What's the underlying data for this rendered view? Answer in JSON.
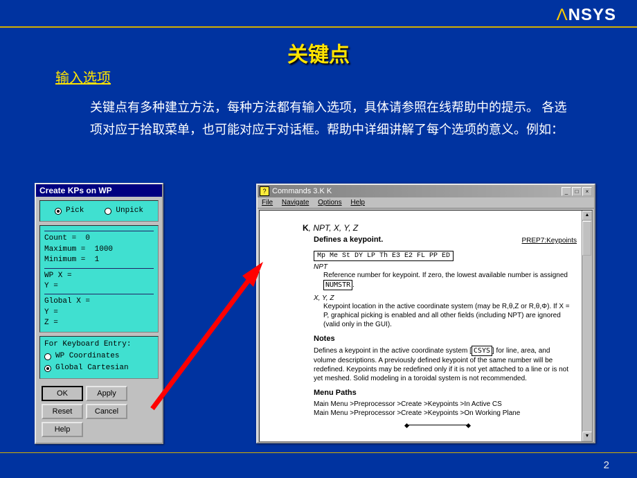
{
  "logo": {
    "brand_prefix": "Λ",
    "brand": "NSYS"
  },
  "page_number": "2",
  "title": "关键点",
  "subtitle": "输入选项",
  "body": "关键点有多种建立方法，每种方法都有输入选项，具体请参照在线帮助中的提示。 各选项对应于拾取菜单，也可能对应于对话框。帮助中详细讲解了每个选项的意义。例如：",
  "dialog1": {
    "title": "Create KPs on WP",
    "pick": "Pick",
    "unpick": "Unpick",
    "rows": [
      {
        "label": "Count   =",
        "value": "0"
      },
      {
        "label": "Maximum =",
        "value": "1000"
      },
      {
        "label": "Minimum =",
        "value": "1"
      },
      {
        "label": "WP X    =",
        "value": ""
      },
      {
        "label": "   Y    =",
        "value": ""
      },
      {
        "label": "Global X =",
        "value": ""
      },
      {
        "label": "       Y =",
        "value": ""
      },
      {
        "label": "       Z =",
        "value": ""
      }
    ],
    "keyboard_label": "For Keyboard Entry:",
    "coord1": "WP Coordinates",
    "coord2": "Global Cartesian",
    "btn_ok": "OK",
    "btn_apply": "Apply",
    "btn_reset": "Reset",
    "btn_cancel": "Cancel",
    "btn_help": "Help"
  },
  "help": {
    "window_title": "Commands 3.K K",
    "menu": {
      "file": "File",
      "navigate": "Navigate",
      "options": "Options",
      "help": "Help"
    },
    "cmd_name": "K",
    "cmd_args": ", NPT, X, Y, Z",
    "def": "Defines a keypoint.",
    "prepref": "PREP7:Keypoints",
    "tabs": "Mp Me St DY LP Th E3 E2 FL PP ED",
    "arg_npt": "NPT",
    "arg_npt_desc_a": "Reference number for keypoint. If zero, the lowest available number is assigned",
    "arg_npt_box": "NUMSTR",
    "arg_xyz": "X, Y, Z",
    "arg_xyz_desc": "Keypoint location in the active coordinate system (may be R,θ,Z or R,θ,Φ). If X = P, graphical picking is enabled and all other fields (including NPT) are ignored (valid only in the GUI).",
    "notes_h": "Notes",
    "notes_box": "CSYS",
    "notes": "Defines a keypoint in the active coordinate system [____] for line, area, and volume descriptions. A previously defined keypoint of the same number will be redefined. Keypoints may be redefined only if it is not yet attached to a line or is not yet meshed. Solid modeling in a toroidal system is not recommended.",
    "menupaths_h": "Menu Paths",
    "mp1": "Main Menu >Preprocessor >Create >Keypoints >In Active CS",
    "mp2": "Main Menu >Preprocessor >Create >Keypoints >On Working Plane"
  }
}
